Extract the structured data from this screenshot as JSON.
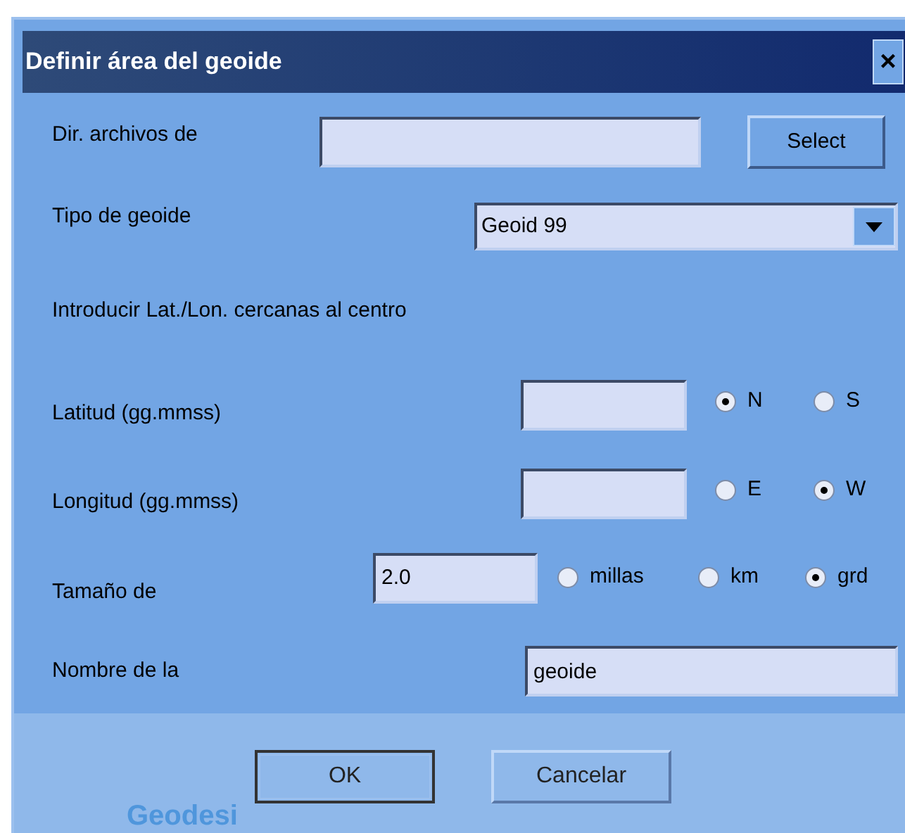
{
  "window": {
    "title": "Definir área del geoide",
    "close": "×"
  },
  "directory": {
    "label": "Dir. archivos de",
    "button": "Select"
  },
  "geoid_type": {
    "label": "Tipo de geoide",
    "value": "Geoid 99"
  },
  "instruction": "Introducir Lat./Lon. cercanas al centro",
  "latitude": {
    "label": "Latitud (gg.mmss)",
    "options": [
      {
        "label": "N",
        "selected": true
      },
      {
        "label": "S",
        "selected": false
      }
    ]
  },
  "longitude": {
    "label": "Longitud (gg.mmss)",
    "options": [
      {
        "label": "E",
        "selected": false
      },
      {
        "label": "W",
        "selected": true
      }
    ]
  },
  "size": {
    "label": "Tamaño de",
    "value": "2.0",
    "options": [
      {
        "label": "millas",
        "selected": false
      },
      {
        "label": "km",
        "selected": false
      },
      {
        "label": "grd",
        "selected": true
      }
    ]
  },
  "name": {
    "label": "Nombre de la",
    "value": "geoide"
  },
  "buttons": [
    {
      "label": "OK",
      "default": true
    },
    {
      "label": "Cancelar",
      "default": false
    }
  ],
  "logo": "Geodesi"
}
